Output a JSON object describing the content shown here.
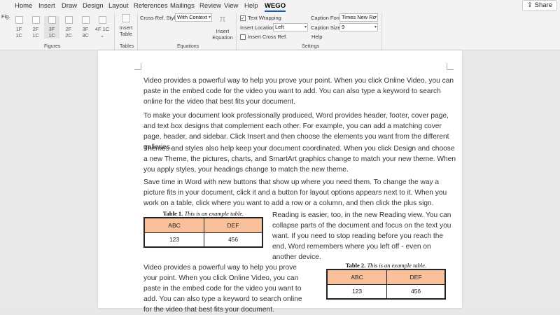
{
  "tabs": [
    "Home",
    "Insert",
    "Draw",
    "Design",
    "Layout",
    "References",
    "Mailings",
    "Review",
    "View",
    "Help",
    "WEGO"
  ],
  "share_label": "Share",
  "ribbon": {
    "fig_prefix": "Fig.",
    "figure_buttons": [
      {
        "top": "1F",
        "bottom": "1C"
      },
      {
        "top": "2F",
        "bottom": "1C"
      },
      {
        "top": "3F",
        "bottom": "1C"
      },
      {
        "top": "2F",
        "bottom": "2C"
      },
      {
        "top": "3F",
        "bottom": "3C"
      },
      {
        "top": "4F 1C",
        "bottom": "⌄"
      }
    ],
    "figures_label": "Figures",
    "insert_table_label1": "Insert",
    "insert_table_label2": "Table",
    "tables_label": "Tables",
    "crossref_label": "Cross Ref. Style",
    "crossref_value": "With Context",
    "insert_equation_label1": "Insert",
    "insert_equation_label2": "Equation",
    "equations_label": "Equations",
    "text_wrapping_label": "Text Wrapping",
    "insert_location_label": "Insert Location",
    "insert_location_value": "Left",
    "insert_crossref_label": "Insert Cross Ref.",
    "caption_font_label": "Caption Font",
    "caption_font_value": "Times New Ro",
    "caption_size_label": "Caption Size",
    "caption_size_value": "9",
    "help_label": "Help",
    "settings_label": "Settings"
  },
  "document": {
    "p1": "Video provides a powerful way to help you prove your point. When you click Online Video, you can paste in the embed code for the video you want to add. You can also type a keyword to search online for the video that best fits your document.",
    "p2": "To make your document look professionally produced, Word provides header, footer, cover page, and text box designs that complement each other. For example, you can add a matching cover page, header, and sidebar. Click Insert and then choose the elements you want from the different galleries.",
    "p3": "Themes and styles also help keep your document coordinated. When you click Design and choose a new Theme, the pictures, charts, and SmartArt graphics change to match your new theme. When you apply styles, your headings change to match the new theme.",
    "p4": "Save time in Word with new buttons that show up where you need them. To change the way a picture fits in your document, click it and a button for layout options appears next to it. When you work on a table, click where you want to add a row or a column, and then click the plus sign.",
    "p5": "Reading is easier, too, in the new Reading view. You can collapse parts of the document and focus on the text you want. If you need to stop reading before you reach the end, Word remembers where you left off - even on another device.",
    "p6": "Video provides a powerful way to help you prove your point. When you click Online Video, you can paste in the embed code for the video you want to add. You can also type a keyword to search online for the video that best fits your document.",
    "table1": {
      "caption_bold": "Table 1.",
      "caption_italic": "This is an example table.",
      "headers": [
        "ABC",
        "DEF"
      ],
      "row": [
        "123",
        "456"
      ]
    },
    "table2": {
      "caption_bold": "Table 2.",
      "caption_italic": "This is an example table.",
      "headers": [
        "ABC",
        "DEF"
      ],
      "row": [
        "123",
        "456"
      ]
    }
  },
  "colors": {
    "table_header": "#f8c09b",
    "accent": "#185abd"
  }
}
